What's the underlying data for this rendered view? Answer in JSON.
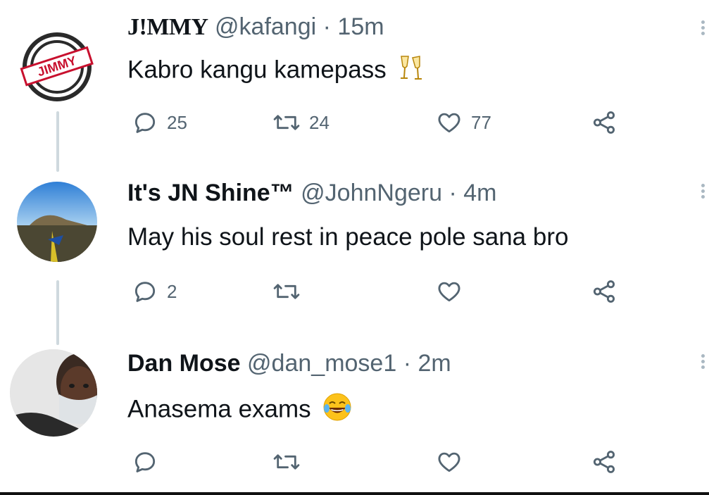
{
  "tweets": [
    {
      "display_name": "J!MMY",
      "handle": "@kafangi",
      "separator": "·",
      "time": "15m",
      "text": "Kabro kangu kamepass",
      "emoji": "champagne-glasses-icon",
      "reply_count": "25",
      "retweet_count": "24",
      "like_count": "77",
      "avatar_text": "JIMMY"
    },
    {
      "display_name": "It's JN Shine™",
      "handle": "@JohnNgeru",
      "separator": "·",
      "time": "4m",
      "text": "May his soul rest in peace pole sana bro",
      "reply_count": "2",
      "retweet_count": "",
      "like_count": ""
    },
    {
      "display_name": "Dan Mose",
      "handle": "@dan_mose1",
      "separator": "·",
      "time": "2m",
      "text": "Anasema exams",
      "emoji": "tears-of-joy-icon",
      "reply_count": "",
      "retweet_count": "",
      "like_count": ""
    }
  ],
  "colors": {
    "text_primary": "#0f1419",
    "text_secondary": "#536471",
    "thread_line": "#cfd9de",
    "logo_red": "#c8102e"
  }
}
